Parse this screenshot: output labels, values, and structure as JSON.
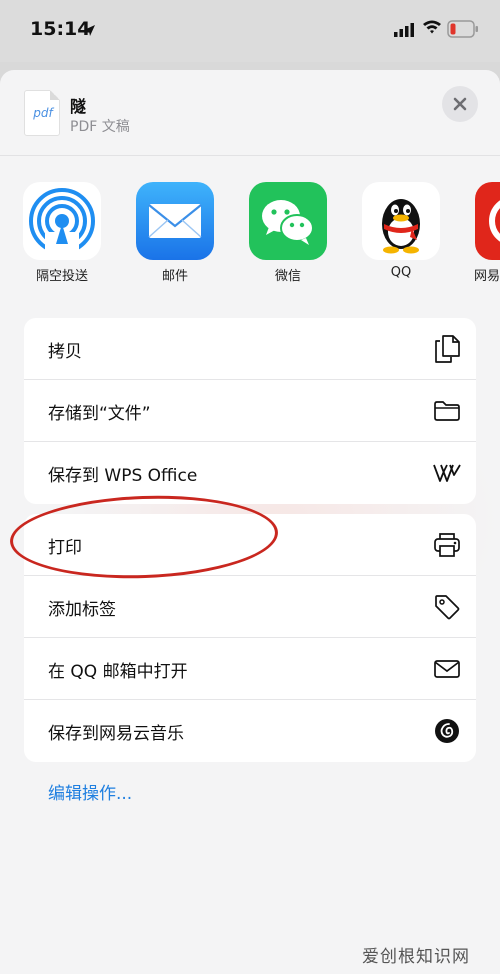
{
  "status_bar": {
    "time": "15:14"
  },
  "file": {
    "name": "隧",
    "type": "PDF 文稿",
    "icon_text": "pdf"
  },
  "apps": [
    {
      "label": "隔空投送",
      "icon": "airdrop-icon"
    },
    {
      "label": "邮件",
      "icon": "mail-icon"
    },
    {
      "label": "微信",
      "icon": "wechat-icon"
    },
    {
      "label": "QQ",
      "icon": "qq-icon"
    },
    {
      "label": "网易",
      "icon": "netease-icon"
    }
  ],
  "group1": [
    {
      "label": "拷贝",
      "icon": "copy-icon"
    },
    {
      "label": "存储到“文件”",
      "icon": "folder-icon"
    },
    {
      "label": "保存到 WPS Office",
      "icon": "wps-icon"
    }
  ],
  "group2": [
    {
      "label": "打印",
      "icon": "printer-icon"
    },
    {
      "label": "添加标签",
      "icon": "tag-icon"
    },
    {
      "label": "在 QQ 邮箱中打开",
      "icon": "envelope-icon"
    },
    {
      "label": "保存到网易云音乐",
      "icon": "netease-music-icon"
    }
  ],
  "edit_actions": "编辑操作...",
  "watermark": "爱创根知识网",
  "colors": {
    "accent": "#1f7fe0",
    "highlight_circle": "#c9271f",
    "battery_low": "#e0352b"
  }
}
